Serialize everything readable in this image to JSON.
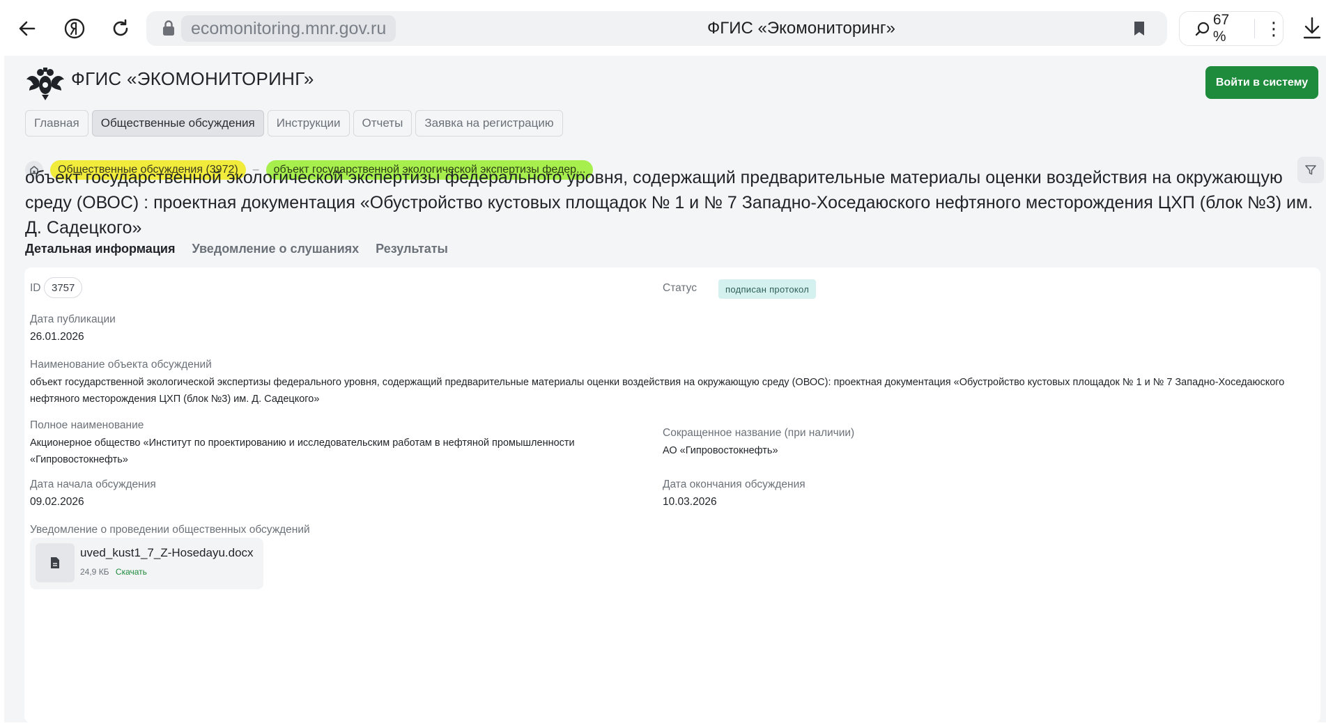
{
  "browser": {
    "url": "ecomonitoring.mnr.gov.ru",
    "tab_title": "ФГИС «Экомониторинг»",
    "zoom": "67 %"
  },
  "header": {
    "brand": "ФГИС «ЭКОМОНИТОРИНГ»",
    "login_label": "Войти в систему"
  },
  "nav": {
    "tabs": [
      {
        "label": "Главная"
      },
      {
        "label": "Общественные обсуждения"
      },
      {
        "label": "Инструкции"
      },
      {
        "label": "Отчеты"
      },
      {
        "label": "Заявка на регистрацию"
      }
    ]
  },
  "breadcrumb": {
    "section": "Общественные обсуждения (3972)",
    "current": "объект государственной экологической экспертизы федер..."
  },
  "object_title": "объект государственной экологической экспертизы федерального уровня, содержащий предварительные материалы оценки воздействия на окружающую среду (ОВОС) : проектная документация «Обустройство кустовых площадок № 1 и № 7 Западно-Хоседаюского нефтяного месторождения ЦХП (блок №3) им. Д. Садецкого»",
  "subtabs": [
    {
      "label": "Детальная информация"
    },
    {
      "label": "Уведомление о слушаниях"
    },
    {
      "label": "Результаты"
    }
  ],
  "details": {
    "id_label": "ID",
    "id_value": "3757",
    "status_label": "Статус",
    "status_value": "подписан протокол",
    "pub_date_label": "Дата публикации",
    "pub_date_value": "26.01.2026",
    "object_name_label": "Наименование объекта обсуждений",
    "object_name_value": "объект государственной экологической экспертизы федерального уровня, содержащий предварительные материалы оценки воздействия на окружающую среду (ОВОС): проектная документация «Обустройство кустовых площадок № 1 и № 7 Западно-Хоседаюского нефтяного месторождения ЦХП (блок №3) им. Д. Садецкого»",
    "full_name_label": "Полное наименование",
    "full_name_value": "Акционерное общество «Институт по проектированию и исследовательским работам в нефтяной промышленности «Гипровостокнефть»",
    "short_name_label": "Сокращенное название (при наличии)",
    "short_name_value": "АО «Гипровостокнефть»",
    "start_date_label": "Дата начала обсуждения",
    "start_date_value": "09.02.2026",
    "end_date_label": "Дата окончания обсуждения",
    "end_date_value": "10.03.2026",
    "notice_label": "Уведомление о проведении общественных обсуждений",
    "file": {
      "name": "uved_kust1_7_Z-Hosedayu.docx",
      "size": "24,9 КБ",
      "download_label": "Скачать"
    }
  },
  "colors": {
    "accent_green": "#1d8a3c",
    "crumb_yellow": "#f1ec3b",
    "crumb_green": "#a7ef4c",
    "status_bg": "#d4f1ef"
  }
}
